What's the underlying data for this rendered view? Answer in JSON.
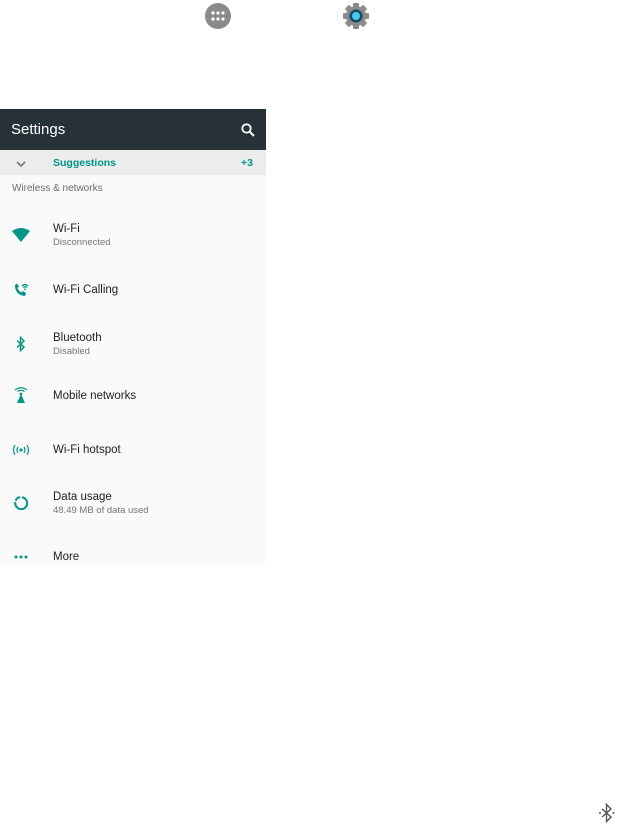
{
  "toolbar": {
    "title": "Settings"
  },
  "suggestions": {
    "label": "Suggestions",
    "count": "+3"
  },
  "section": {
    "wireless_header": "Wireless & networks"
  },
  "items": [
    {
      "id": "wifi",
      "label": "Wi-Fi",
      "summary": "Disconnected",
      "icon": "wifi-icon"
    },
    {
      "id": "wifi-calling",
      "label": "Wi-Fi Calling",
      "summary": "",
      "icon": "wifi-calling-icon"
    },
    {
      "id": "bluetooth",
      "label": "Bluetooth",
      "summary": "Disabled",
      "icon": "bluetooth-icon"
    },
    {
      "id": "mobile-networks",
      "label": "Mobile networks",
      "summary": "",
      "icon": "mobile-networks-icon"
    },
    {
      "id": "wifi-hotspot",
      "label": "Wi-Fi hotspot",
      "summary": "",
      "icon": "hotspot-icon"
    },
    {
      "id": "data-usage",
      "label": "Data usage",
      "summary": "48.49 MB of data used",
      "icon": "data-usage-icon"
    },
    {
      "id": "more",
      "label": "More",
      "summary": "",
      "icon": "more-icon"
    }
  ],
  "colors": {
    "toolbar_bg": "#263238",
    "accent": "#009688",
    "icon_gray": "#8a8a8a"
  }
}
